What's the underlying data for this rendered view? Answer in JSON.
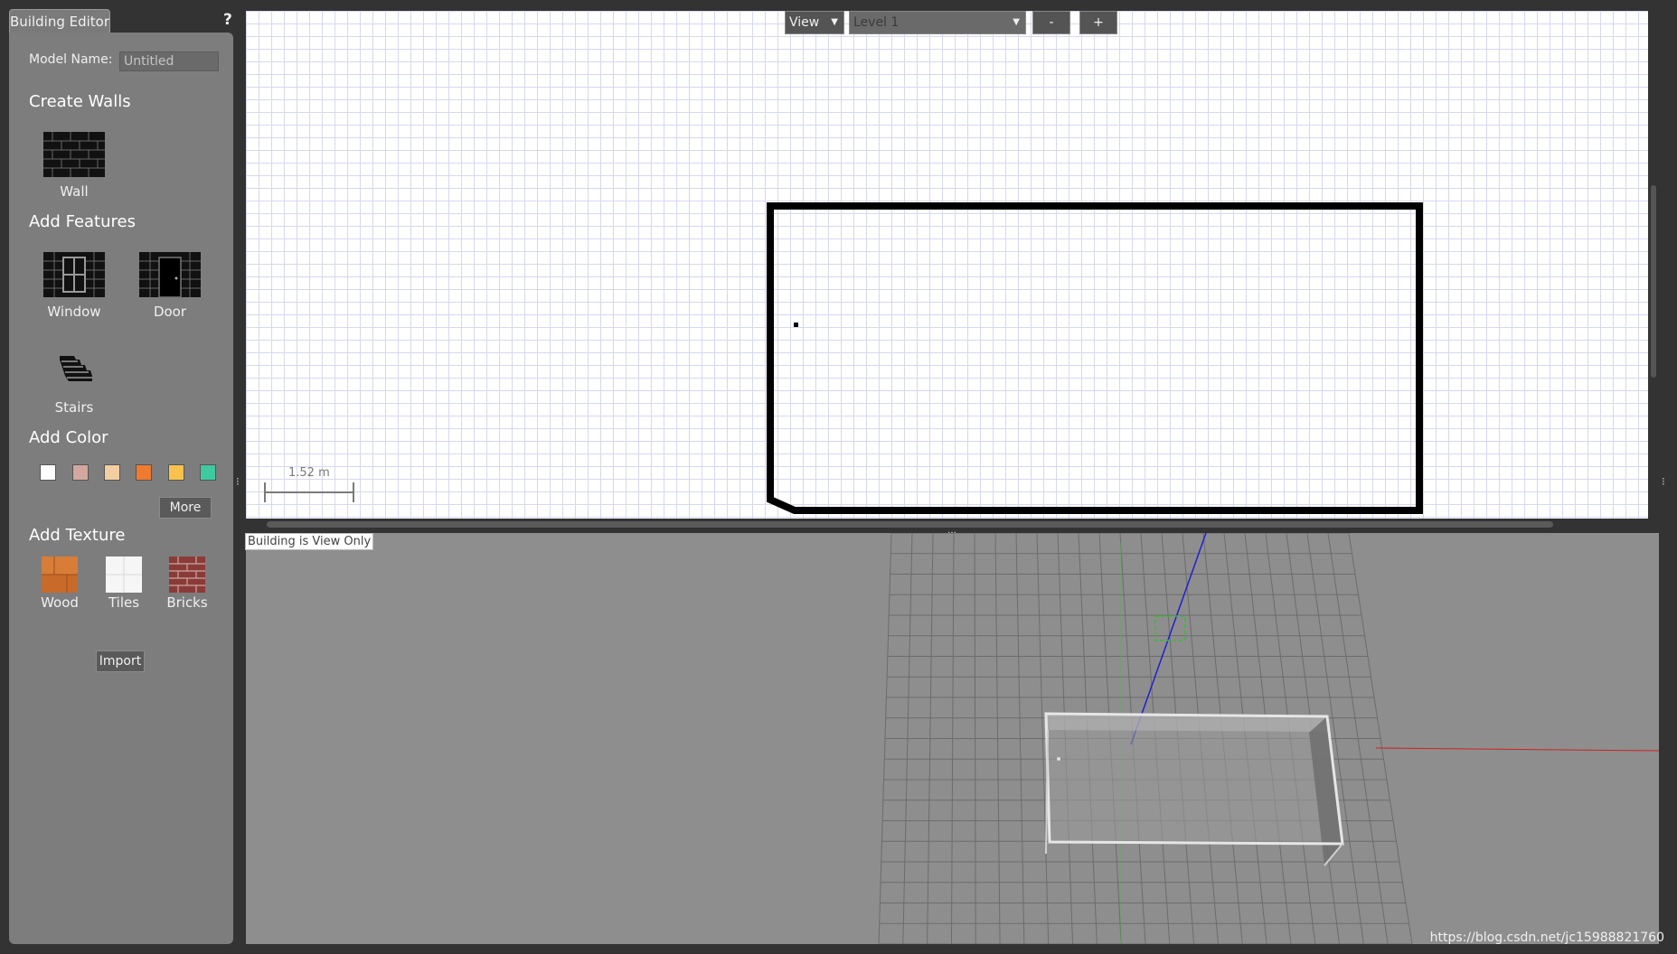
{
  "palette": {
    "tab_title": "Building Editor",
    "help_label": "?",
    "model_name_label": "Model Name:",
    "model_name_value": "Untitled",
    "create_walls_heading": "Create Walls",
    "wall_label": "Wall",
    "add_features_heading": "Add Features",
    "window_label": "Window",
    "door_label": "Door",
    "stairs_label": "Stairs",
    "add_color_heading": "Add Color",
    "colors": [
      "#ffffff",
      "#d2a89e",
      "#f3cea0",
      "#f07a30",
      "#f9c24f",
      "#3ec9a0"
    ],
    "more_label": "More",
    "add_texture_heading": "Add Texture",
    "wood_label": "Wood",
    "tiles_label": "Tiles",
    "bricks_label": "Bricks",
    "import_label": "Import"
  },
  "plan": {
    "view_menu": "View",
    "level_select": "Level 1",
    "minus_label": "-",
    "plus_label": "+",
    "scale_label": "1.52 m"
  },
  "view3d": {
    "status_text": "Building is View Only",
    "grip": "…"
  },
  "watermark": "https://blog.csdn.net/jc15988821760"
}
